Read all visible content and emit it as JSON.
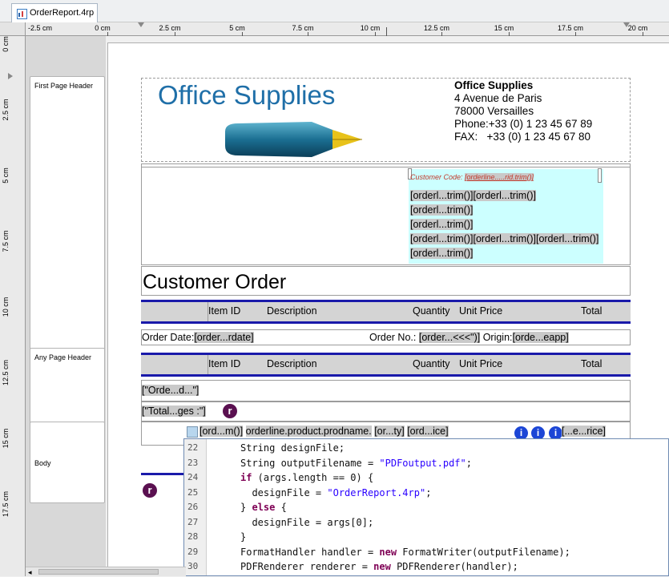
{
  "tab": {
    "title": "OrderReport.4rp"
  },
  "ruler": {
    "h_labels": [
      "-2.5 cm",
      "0 cm",
      "2.5 cm",
      "5 cm",
      "7.5 cm",
      "10 cm",
      "12.5 cm",
      "15 cm",
      "17.5 cm",
      "20 cm"
    ],
    "v_labels": [
      "0 cm",
      "2.5 cm",
      "5 cm",
      "7.5 cm",
      "10 cm",
      "12.5 cm",
      "15 cm",
      "17.5 cm"
    ]
  },
  "sections": {
    "first_page_header": "First Page Header",
    "any_page_header": "Any Page Header",
    "body": "Body"
  },
  "report": {
    "logo_office": "Office",
    "logo_supplies": "Supplies",
    "company_name": "Office Supplies",
    "address1": "4 Avenue de Paris",
    "address2": "78000 Versailles",
    "phone": "Phone:+33 (0) 1 23 45 67 89",
    "fax_label": "FAX:",
    "fax_number": "+33 (0) 1 23 45 67 80",
    "customer_code_label": "Customer Code:",
    "customer_code_field": "[orderline.....rid.trim()]",
    "addr_line1a": "[orderl...trim()]",
    "addr_line1b": "[orderl...trim()]",
    "addr_line2": "[orderl...trim()]",
    "addr_line3": "[orderl...trim()]",
    "addr_line4a": "[orderl...trim()]",
    "addr_line4b": "[orderl...trim()]",
    "addr_line4c": "[orderl...trim()]",
    "addr_line5": "[orderl...trim()]",
    "title": "Customer Order",
    "col_item_id": "Item ID",
    "col_description": "Description",
    "col_quantity": "Quantity",
    "col_unit_price": "Unit Price",
    "col_total": "Total",
    "order_date_label": "Order Date:",
    "order_date_field": "[order...rdate]",
    "order_no_label": "Order No.:",
    "order_no_field": "[order...<<<\")]",
    "origin_label": "Origin:",
    "origin_field": "[orde...eapp]",
    "group_field": "[\"Orde...d...\"]",
    "total_pages_field": "[\"Total...ges :\"]",
    "detail_f1": "[ord...m()]",
    "detail_f2": "orderline.product.prodname.",
    "detail_f3": "[or...ty]",
    "detail_f4": "[ord...ice]",
    "detail_f5": "[...e...rice]",
    "badge_r": "r",
    "badge_i": "i"
  },
  "code": {
    "lines": [
      {
        "n": "22",
        "text": "String designFile;"
      },
      {
        "n": "23",
        "text": "String outputFilename = \"PDFoutput.pdf\";"
      },
      {
        "n": "24",
        "text": "if (args.length == 0) {"
      },
      {
        "n": "25",
        "text": "  designFile = \"OrderReport.4rp\";"
      },
      {
        "n": "26",
        "text": "} else {"
      },
      {
        "n": "27",
        "text": "  designFile = args[0];"
      },
      {
        "n": "28",
        "text": "}"
      },
      {
        "n": "29",
        "text": "FormatHandler handler = new FormatWriter(outputFilename);"
      },
      {
        "n": "30",
        "text": "PDFRenderer renderer = new PDFRenderer(handler);"
      }
    ]
  },
  "colors": {
    "accent_blue": "#1a1aaa",
    "logo_blue": "#1f6fa8",
    "highlight_cyan": "#ccffff",
    "badge_purple": "#5a1050",
    "info_blue": "#1c46d6"
  }
}
